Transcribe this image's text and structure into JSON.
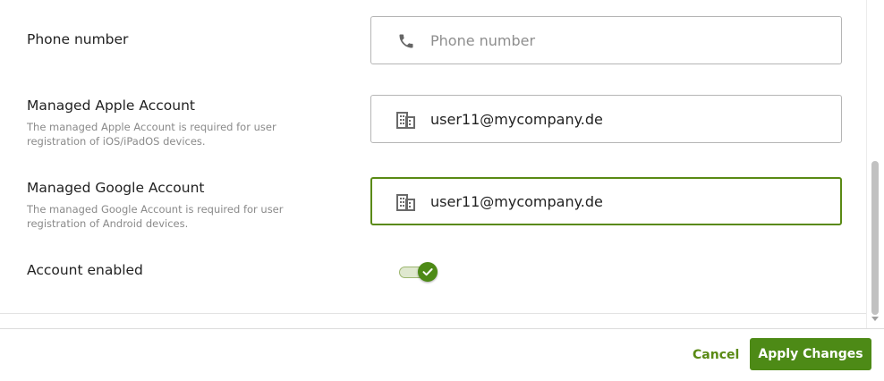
{
  "form": {
    "phone": {
      "label": "Phone number",
      "value": "",
      "placeholder": "Phone number",
      "icon": "phone-icon"
    },
    "apple": {
      "label": "Managed Apple Account",
      "description": "The managed Apple Account is required for user registration of iOS/iPadOS devices.",
      "value": "user11@mycompany.de",
      "icon": "building-icon"
    },
    "google": {
      "label": "Managed Google Account",
      "description": "The managed Google Account is required for user registration of Android devices.",
      "value": "user11@mycompany.de",
      "icon": "building-icon"
    },
    "account_enabled": {
      "label": "Account enabled",
      "enabled": true
    }
  },
  "footer": {
    "cancel_label": "Cancel",
    "apply_label": "Apply Changes"
  },
  "colors": {
    "accent": "#4d8a16",
    "accent_text": "#5a8a14",
    "field_border": "#b5b5b5",
    "description_text": "#8a8a8a"
  }
}
